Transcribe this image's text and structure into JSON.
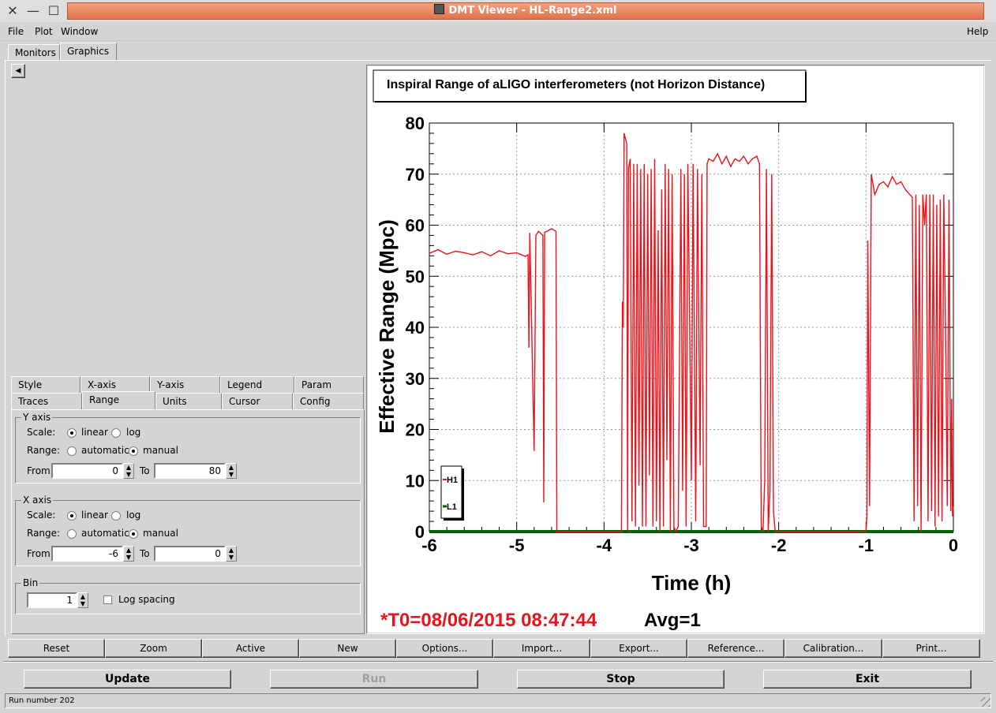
{
  "window": {
    "title": "DMT Viewer - HL-Range2.xml"
  },
  "menubar": {
    "file": "File",
    "plot": "Plot",
    "window": "Window",
    "help": "Help"
  },
  "main_tabs": {
    "monitors": "Monitors",
    "graphics": "Graphics"
  },
  "option_tabs": {
    "row1": [
      "Style",
      "X-axis",
      "Y-axis",
      "Legend",
      "Param"
    ],
    "row2": [
      "Traces",
      "Range",
      "Units",
      "Cursor",
      "Config"
    ]
  },
  "y_axis_group": {
    "title": "Y axis",
    "scale_label": "Scale:",
    "linear": "linear",
    "log": "log",
    "scale_selected": "linear",
    "range_label": "Range:",
    "automatic": "automatic",
    "manual": "manual",
    "range_selected": "manual",
    "from_label": "From",
    "from_value": "0",
    "to_label": "To",
    "to_value": "80"
  },
  "x_axis_group": {
    "title": "X axis",
    "scale_label": "Scale:",
    "linear": "linear",
    "log": "log",
    "scale_selected": "linear",
    "range_label": "Range:",
    "automatic": "automatic",
    "manual": "manual",
    "range_selected": "manual",
    "from_label": "From",
    "from_value": "-6",
    "to_label": "To",
    "to_value": "0"
  },
  "bin_group": {
    "title": "Bin",
    "value": "1",
    "log_spacing_label": "Log spacing",
    "log_spacing_checked": false
  },
  "plot_buttons": [
    "Reset",
    "Zoom",
    "Active",
    "New",
    "Options...",
    "Import...",
    "Export...",
    "Reference...",
    "Calibration...",
    "Print..."
  ],
  "control_buttons": {
    "update": "Update",
    "run": "Run",
    "stop": "Stop",
    "exit": "Exit"
  },
  "status_bar": {
    "text": "Run number 202"
  },
  "colors": {
    "h1_trace": "#e8141c",
    "l1_trace": "#006400",
    "title_bar": "#e47a54",
    "t0_text": "#e8141c"
  },
  "chart_data": {
    "type": "line",
    "title": "Inspiral Range of aLIGO interferometers (not Horizon Distance)",
    "xlabel": "Time (h)",
    "ylabel": "Effective Range (Mpc)",
    "xlim": [
      -6,
      0
    ],
    "ylim": [
      0,
      80
    ],
    "xticks": [
      "-6",
      "-5",
      "-4",
      "-3",
      "-2",
      "-1",
      "0"
    ],
    "yticks": [
      "0",
      "10",
      "20",
      "30",
      "40",
      "50",
      "60",
      "70",
      "80"
    ],
    "grid": true,
    "legend": [
      "H1",
      "L1"
    ],
    "t0_label": "*T0=08/06/2015 08:47:44",
    "avg_label": "Avg=1",
    "series": [
      {
        "name": "H1",
        "color": "#e8141c",
        "points": [
          [
            -6.0,
            54.5
          ],
          [
            -5.9,
            55.2
          ],
          [
            -5.8,
            54.3
          ],
          [
            -5.7,
            54.9
          ],
          [
            -5.6,
            54.6
          ],
          [
            -5.5,
            54.2
          ],
          [
            -5.4,
            54.8
          ],
          [
            -5.3,
            54.0
          ],
          [
            -5.2,
            55.0
          ],
          [
            -5.1,
            54.4
          ],
          [
            -5.0,
            54.6
          ],
          [
            -4.9,
            53.9
          ],
          [
            -4.87,
            54.2
          ],
          [
            -4.86,
            36
          ],
          [
            -4.85,
            58.5
          ],
          [
            -4.8,
            15.8
          ],
          [
            -4.78,
            58.0
          ],
          [
            -4.75,
            58.8
          ],
          [
            -4.7,
            58.0
          ],
          [
            -4.69,
            5.7
          ],
          [
            -4.68,
            58.6
          ],
          [
            -4.6,
            59.3
          ],
          [
            -4.55,
            58.8
          ],
          [
            -4.54,
            0
          ],
          [
            -3.8,
            0
          ],
          [
            -3.79,
            45
          ],
          [
            -3.78,
            40
          ],
          [
            -3.77,
            78
          ],
          [
            -3.74,
            76
          ],
          [
            -3.73,
            0
          ],
          [
            -3.72,
            71
          ],
          [
            -3.7,
            73
          ],
          [
            -3.68,
            2
          ],
          [
            -3.66,
            72
          ],
          [
            -3.64,
            1
          ],
          [
            -3.62,
            72
          ],
          [
            -3.6,
            9
          ],
          [
            -3.58,
            71
          ],
          [
            -3.56,
            1
          ],
          [
            -3.54,
            72
          ],
          [
            -3.52,
            1
          ],
          [
            -3.5,
            70
          ],
          [
            -3.48,
            11
          ],
          [
            -3.46,
            71
          ],
          [
            -3.44,
            1
          ],
          [
            -3.42,
            73
          ],
          [
            -3.4,
            2
          ],
          [
            -3.38,
            59
          ],
          [
            -3.36,
            0
          ],
          [
            -3.34,
            67
          ],
          [
            -3.32,
            1
          ],
          [
            -3.3,
            72
          ],
          [
            -3.28,
            14
          ],
          [
            -3.26,
            71
          ],
          [
            -3.24,
            0
          ],
          [
            -3.22,
            70
          ],
          [
            -3.2,
            1
          ],
          [
            -3.18,
            0
          ],
          [
            -3.15,
            1
          ],
          [
            -3.12,
            71
          ],
          [
            -3.1,
            8
          ],
          [
            -3.08,
            70
          ],
          [
            -3.06,
            1
          ],
          [
            -3.04,
            72
          ],
          [
            -3.02,
            41
          ],
          [
            -3.0,
            10
          ],
          [
            -2.98,
            72
          ],
          [
            -2.95,
            2
          ],
          [
            -2.93,
            71
          ],
          [
            -2.9,
            13
          ],
          [
            -2.88,
            70
          ],
          [
            -2.86,
            1
          ],
          [
            -2.83,
            1
          ],
          [
            -2.82,
            72
          ],
          [
            -2.8,
            73
          ],
          [
            -2.75,
            72.5
          ],
          [
            -2.7,
            74
          ],
          [
            -2.65,
            72
          ],
          [
            -2.6,
            73.5
          ],
          [
            -2.55,
            71.5
          ],
          [
            -2.5,
            73
          ],
          [
            -2.45,
            72.5
          ],
          [
            -2.4,
            73.5
          ],
          [
            -2.35,
            72
          ],
          [
            -2.3,
            73
          ],
          [
            -2.25,
            73.5
          ],
          [
            -2.22,
            72
          ],
          [
            -2.2,
            1
          ],
          [
            -2.18,
            0
          ],
          [
            -2.16,
            10
          ],
          [
            -2.14,
            71
          ],
          [
            -2.12,
            0
          ],
          [
            -2.1,
            8
          ],
          [
            -2.08,
            70
          ],
          [
            -2.06,
            4
          ],
          [
            -2.04,
            0
          ],
          [
            -2.03,
            0
          ],
          [
            -1.0,
            0
          ],
          [
            -0.99,
            3
          ],
          [
            -0.98,
            57
          ],
          [
            -0.96,
            5
          ],
          [
            -0.94,
            70
          ],
          [
            -0.9,
            66
          ],
          [
            -0.85,
            68
          ],
          [
            -0.8,
            68.5
          ],
          [
            -0.75,
            67.5
          ],
          [
            -0.7,
            69.5
          ],
          [
            -0.65,
            68
          ],
          [
            -0.6,
            68.5
          ],
          [
            -0.55,
            67
          ],
          [
            -0.5,
            66
          ],
          [
            -0.47,
            65.5
          ],
          [
            -0.45,
            2
          ],
          [
            -0.43,
            66
          ],
          [
            -0.41,
            5
          ],
          [
            -0.39,
            64
          ],
          [
            -0.37,
            0
          ],
          [
            -0.35,
            66
          ],
          [
            -0.33,
            60
          ],
          [
            -0.31,
            66
          ],
          [
            -0.29,
            2
          ],
          [
            -0.27,
            66
          ],
          [
            -0.25,
            4
          ],
          [
            -0.23,
            66
          ],
          [
            -0.21,
            1
          ],
          [
            -0.19,
            64
          ],
          [
            -0.17,
            3
          ],
          [
            -0.15,
            65
          ],
          [
            -0.13,
            2
          ],
          [
            -0.11,
            66
          ],
          [
            -0.09,
            40
          ],
          [
            -0.07,
            5
          ],
          [
            -0.05,
            65
          ],
          [
            -0.03,
            4
          ],
          [
            -0.02,
            26
          ],
          [
            -0.01,
            3
          ],
          [
            0.0,
            5
          ]
        ]
      },
      {
        "name": "L1",
        "color": "#006400",
        "points": [
          [
            -6.0,
            0
          ],
          [
            0.0,
            0
          ]
        ]
      }
    ]
  }
}
